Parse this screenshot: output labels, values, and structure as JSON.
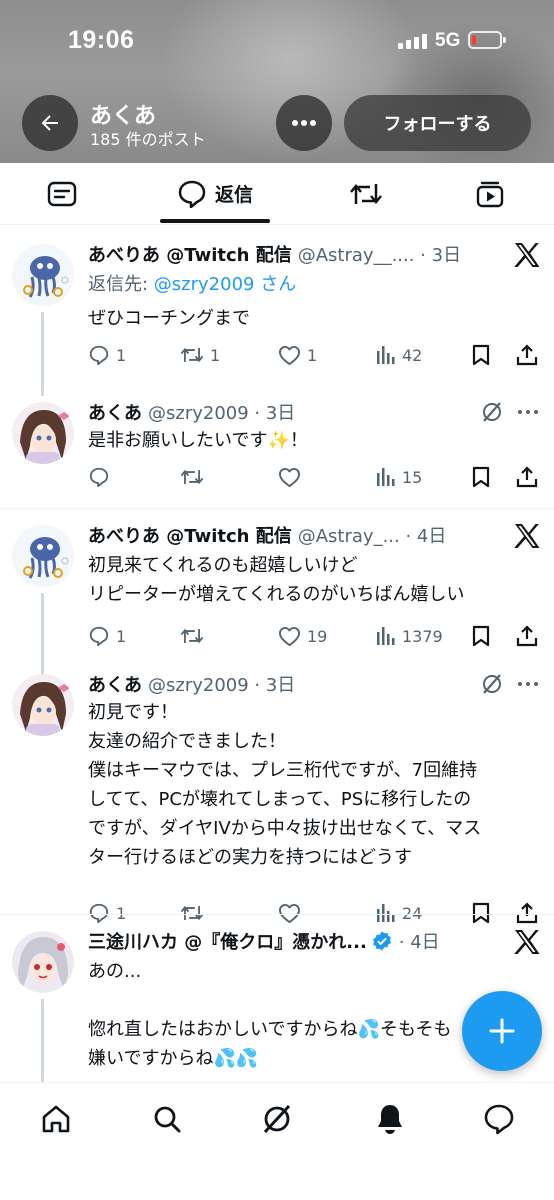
{
  "status_bar": {
    "time": "19:06",
    "network": "5G",
    "battery_color": "#ff3b30"
  },
  "header": {
    "name": "あくあ",
    "post_count": "185 件のポスト",
    "follow_label": "フォローする"
  },
  "tabs": [
    {
      "label": "",
      "icon": "posts-icon",
      "active": false
    },
    {
      "label": "返信",
      "icon": "reply-icon",
      "active": true
    },
    {
      "label": "",
      "icon": "repost-icon",
      "active": false
    },
    {
      "label": "",
      "icon": "media-icon",
      "active": false
    }
  ],
  "tweets": [
    {
      "name": "あべりあ @Twitch 配信",
      "handle": "@Astray__.... · 3日",
      "reply_prefix": "返信先: ",
      "reply_mention": "@szry2009 さん",
      "text": "ぜひコーチングまで",
      "replies": "1",
      "reposts": "1",
      "likes": "1",
      "views": "42"
    },
    {
      "name": "あくあ",
      "handle": "@szry2009 · 3日",
      "text": "是非お願いしたいです✨！",
      "replies": "",
      "reposts": "",
      "likes": "",
      "views": "15"
    },
    {
      "name": "あべりあ @Twitch 配信",
      "handle": "@Astray_... · 4日",
      "text": "初見来てくれるのも超嬉しいけど\nリピーターが増えてくれるのがいちばん嬉しい",
      "replies": "1",
      "reposts": "",
      "likes": "19",
      "views": "1379"
    },
    {
      "name": "あくあ",
      "handle": "@szry2009 · 3日",
      "text": "初見です！\n友達の紹介できました！\n僕はキーマウでは、プレ三桁代ですが、7回維持\nしてて、PCが壊れてしまって、PSに移行したの\nですが、ダイヤIVから中々抜け出せなくて、マス\nター行けるほどの実力を持つにはどうす",
      "replies": "1",
      "reposts": "",
      "likes": "",
      "views": "24"
    },
    {
      "name": "三途川ハカ @『俺クロ』憑かれ...",
      "handle": "· 4日",
      "verified_color": "#1d9bf0",
      "text": "あの...\n\n惚れ直したはおかしいですからね💦そもそも\n嫌いですからね💦💦"
    }
  ],
  "colors": {
    "accent": "#1d9bf0",
    "muted": "#536471",
    "text": "#0f1419"
  }
}
